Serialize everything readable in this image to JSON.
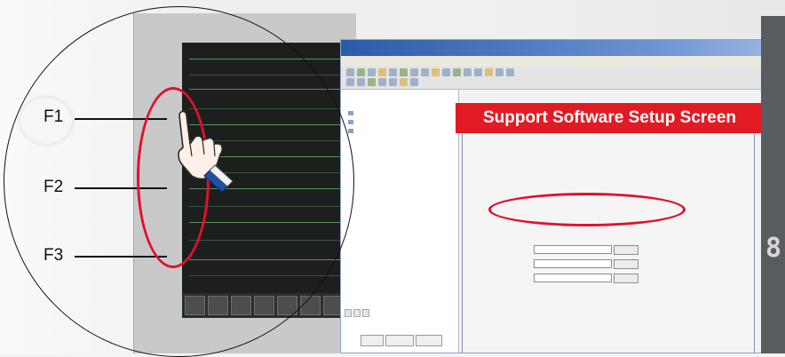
{
  "caption": {
    "text": "Support Software Setup Screen",
    "color": "#e11b24"
  },
  "callouts": [
    {
      "label": "F1"
    },
    {
      "label": "F2"
    },
    {
      "label": "F3"
    }
  ],
  "accent_colors": {
    "highlight_oval": "#e0122e",
    "title_bar": "#2b5aa8",
    "screen_line": "#6fb874"
  },
  "icons": [
    "pointing-hand-icon",
    "toolbar-icon",
    "tree-node-icon"
  ],
  "right_panel": {
    "digit": "8"
  }
}
